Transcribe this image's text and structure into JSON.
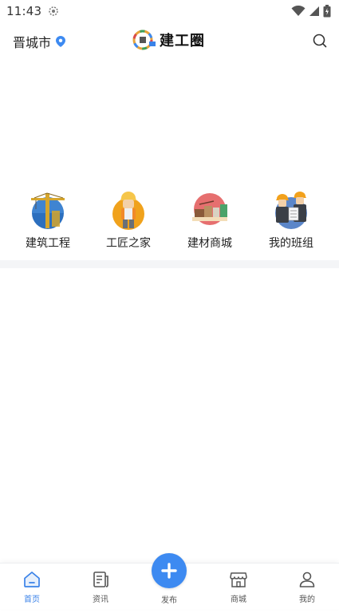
{
  "status_bar": {
    "time": "11:43"
  },
  "header": {
    "city": "晋城市",
    "logo_text": "建工圈"
  },
  "categories": [
    {
      "label": "建筑工程",
      "icon": "construction-crane-icon"
    },
    {
      "label": "工匠之家",
      "icon": "worker-icon"
    },
    {
      "label": "建材商城",
      "icon": "materials-store-icon"
    },
    {
      "label": "我的班组",
      "icon": "team-icon"
    }
  ],
  "bottom_nav": {
    "items": [
      {
        "label": "首页",
        "icon": "home-icon",
        "active": true
      },
      {
        "label": "资讯",
        "icon": "news-icon",
        "active": false
      },
      {
        "label": "发布",
        "icon": "plus-icon",
        "active": false
      },
      {
        "label": "商城",
        "icon": "shop-icon",
        "active": false
      },
      {
        "label": "我的",
        "icon": "user-icon",
        "active": false
      }
    ]
  },
  "colors": {
    "accent": "#3d8af1",
    "active_nav": "#3a82e8",
    "divider": "#f4f5f7"
  }
}
